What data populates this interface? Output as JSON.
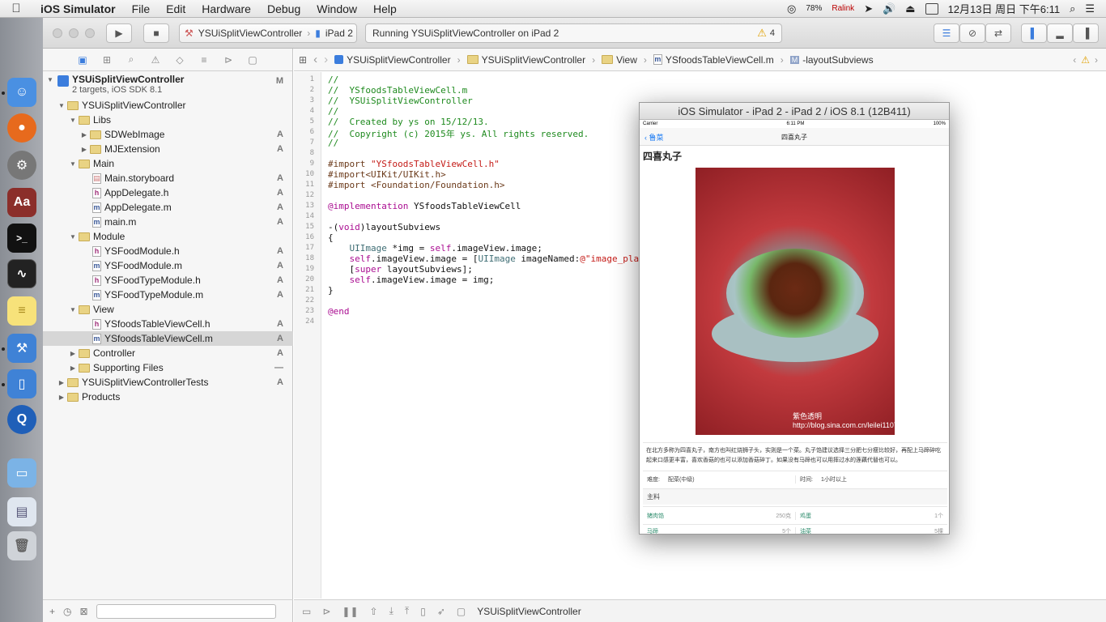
{
  "menubar": {
    "app": "iOS Simulator",
    "items": [
      "File",
      "Edit",
      "Hardware",
      "Debug",
      "Window",
      "Help"
    ],
    "battery": "78%",
    "ralink": "Ralink",
    "datetime": "12月13日 周日 下午6:11"
  },
  "toolbar": {
    "scheme": "YSUiSplitViewController",
    "device": "iPad 2",
    "activity": "Running YSUiSplitViewController on iPad 2",
    "warnings": "4"
  },
  "navigator": {
    "project": "YSUiSplitViewController",
    "project_sub": "2 targets, iOS SDK 8.1",
    "project_badge": "M",
    "rows": [
      {
        "label": "YSUiSplitViewController",
        "type": "group",
        "badge": ""
      },
      {
        "label": "Libs",
        "type": "group",
        "badge": ""
      },
      {
        "label": "SDWebImage",
        "type": "group",
        "badge": "A"
      },
      {
        "label": "MJExtension",
        "type": "group",
        "badge": "A"
      },
      {
        "label": "Main",
        "type": "group",
        "badge": ""
      },
      {
        "label": "Main.storyboard",
        "type": "file",
        "badge": "A"
      },
      {
        "label": "AppDelegate.h",
        "type": "file",
        "badge": "A"
      },
      {
        "label": "AppDelegate.m",
        "type": "file",
        "badge": "A"
      },
      {
        "label": "main.m",
        "type": "file",
        "badge": "A"
      },
      {
        "label": "Module",
        "type": "group",
        "badge": ""
      },
      {
        "label": "YSFoodModule.h",
        "type": "file",
        "badge": "A"
      },
      {
        "label": "YSFoodModule.m",
        "type": "file",
        "badge": "A"
      },
      {
        "label": "YSFoodTypeModule.h",
        "type": "file",
        "badge": "A"
      },
      {
        "label": "YSFoodTypeModule.m",
        "type": "file",
        "badge": "A"
      },
      {
        "label": "View",
        "type": "group",
        "badge": ""
      },
      {
        "label": "YSfoodsTableViewCell.h",
        "type": "file",
        "badge": "A"
      },
      {
        "label": "YSfoodsTableViewCell.m",
        "type": "file",
        "badge": "A"
      },
      {
        "label": "Controller",
        "type": "group",
        "badge": "A"
      },
      {
        "label": "Supporting Files",
        "type": "group",
        "badge": "—"
      },
      {
        "label": "YSUiSplitViewControllerTests",
        "type": "group",
        "badge": "A"
      },
      {
        "label": "Products",
        "type": "group",
        "badge": ""
      }
    ]
  },
  "jumpbar": {
    "crumbs": [
      "YSUiSplitViewController",
      "YSUiSplitViewController",
      "View",
      "YSfoodsTableViewCell.m",
      "-layoutSubviews"
    ]
  },
  "code": {
    "lines": [
      "//",
      "//  YSfoodsTableViewCell.m",
      "//  YSUiSplitViewController",
      "//",
      "//  Created by ys on 15/12/13.",
      "//  Copyright (c) 2015年 ys. All rights reserved.",
      "//",
      "",
      "#import \"YSfoodsTableViewCell.h\"",
      "#import<UIKit/UIKit.h>",
      "#import <Foundation/Foundation.h>",
      "",
      "@implementation YSfoodsTableViewCell",
      "",
      "-(void)layoutSubviews",
      "{",
      "    UIImage *img = self.imageView.image;",
      "    self.imageView.image = [UIImage imageNamed:@\"image_pla",
      "    [super layoutSubviews];",
      "    self.imageView.image = img;",
      "}",
      "",
      "@end",
      ""
    ]
  },
  "debugbar": {
    "target": "YSUiSplitViewController"
  },
  "simulator": {
    "title": "iOS Simulator - iPad 2 - iPad 2 / iOS 8.1 (12B411)",
    "carrier": "Carrier",
    "time": "6:11 PM",
    "battery": "100%",
    "back": "鲁菜",
    "nav_title": "四喜丸子",
    "dish_name": "四喜丸子",
    "watermark": "紫色透明 http://blog.sina.com.cn/leilei1107",
    "description": "在北方多称为四喜丸子，南方也叫红烧狮子头，实则是一个菜。丸子馅建议选择三分肥七分瘦比较好，再配上马蹄碎吃起来口感更丰富，喜欢香菇的也可以添加香菇碎丁。如果没有马蹄也可以用摔过水的莲藕代替也可以。",
    "difficulty_label": "难度:",
    "difficulty_value": "配菜(中级)",
    "time_label": "时间:",
    "time_value": "1小时以上",
    "main_label": "主料",
    "ingredients": [
      {
        "name": "猪肉馅",
        "qty": "250克"
      },
      {
        "name": "鸡蛋",
        "qty": "1个"
      },
      {
        "name": "马蹄",
        "qty": "5个"
      },
      {
        "name": "油菜",
        "qty": "5棵"
      }
    ]
  },
  "colors": {
    "accent": "#3b7ddd",
    "ios_tint": "#1c7cf4",
    "comment": "#1e8a1e",
    "keyword": "#aa0d91"
  }
}
